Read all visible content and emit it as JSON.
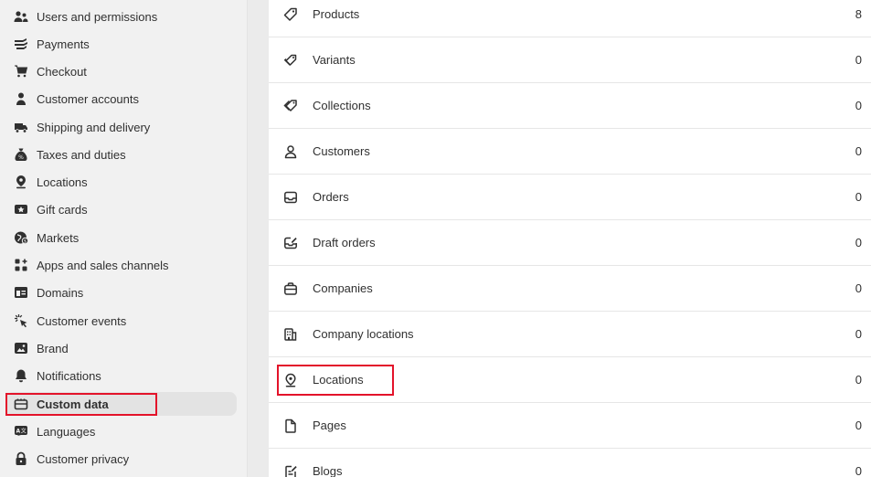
{
  "sidebar": {
    "items": [
      {
        "label": "Users and permissions",
        "icon": "users-icon"
      },
      {
        "label": "Payments",
        "icon": "payments-icon"
      },
      {
        "label": "Checkout",
        "icon": "cart-icon"
      },
      {
        "label": "Customer accounts",
        "icon": "person-icon"
      },
      {
        "label": "Shipping and delivery",
        "icon": "truck-icon"
      },
      {
        "label": "Taxes and duties",
        "icon": "tax-bag-icon"
      },
      {
        "label": "Locations",
        "icon": "location-pin-icon"
      },
      {
        "label": "Gift cards",
        "icon": "gift-card-icon"
      },
      {
        "label": "Markets",
        "icon": "globe-icon"
      },
      {
        "label": "Apps and sales channels",
        "icon": "apps-icon"
      },
      {
        "label": "Domains",
        "icon": "domain-icon"
      },
      {
        "label": "Customer events",
        "icon": "cursor-click-icon"
      },
      {
        "label": "Brand",
        "icon": "brand-icon"
      },
      {
        "label": "Notifications",
        "icon": "bell-icon"
      },
      {
        "label": "Custom data",
        "icon": "custom-data-icon",
        "active": true
      },
      {
        "label": "Languages",
        "icon": "language-icon"
      },
      {
        "label": "Customer privacy",
        "icon": "lock-icon"
      }
    ]
  },
  "metafields": {
    "rows": [
      {
        "label": "Products",
        "count": "8",
        "icon": "tag-icon"
      },
      {
        "label": "Variants",
        "count": "0",
        "icon": "variant-tag-icon"
      },
      {
        "label": "Collections",
        "count": "0",
        "icon": "collection-icon"
      },
      {
        "label": "Customers",
        "count": "0",
        "icon": "customer-icon"
      },
      {
        "label": "Orders",
        "count": "0",
        "icon": "inbox-icon"
      },
      {
        "label": "Draft orders",
        "count": "0",
        "icon": "draft-order-icon"
      },
      {
        "label": "Companies",
        "count": "0",
        "icon": "briefcase-icon"
      },
      {
        "label": "Company locations",
        "count": "0",
        "icon": "building-icon"
      },
      {
        "label": "Locations",
        "count": "0",
        "icon": "location-icon"
      },
      {
        "label": "Pages",
        "count": "0",
        "icon": "page-icon"
      },
      {
        "label": "Blogs",
        "count": "0",
        "icon": "blog-icon"
      }
    ]
  },
  "colors": {
    "highlight": "#e3132a",
    "sidebar_bg": "#f1f1f1",
    "active_bg": "#e3e3e3"
  }
}
